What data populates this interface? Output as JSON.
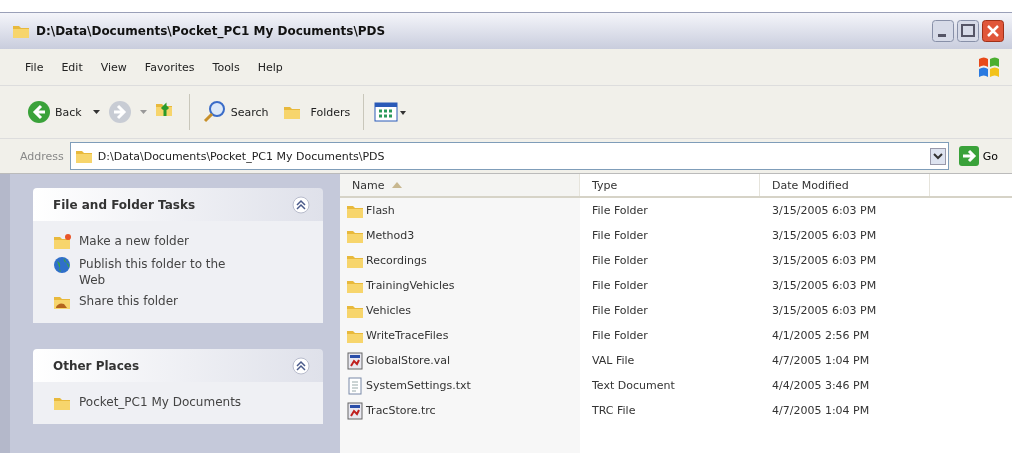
{
  "window": {
    "title": "D:\\Data\\Documents\\Pocket_PC1 My Documents\\PDS"
  },
  "menu": [
    "File",
    "Edit",
    "View",
    "Favorites",
    "Tools",
    "Help"
  ],
  "toolbar": {
    "back": "Back",
    "search": "Search",
    "folders": "Folders"
  },
  "address": {
    "label": "Address",
    "value": "D:\\Data\\Documents\\Pocket_PC1 My Documents\\PDS",
    "go": "Go"
  },
  "sidebar": [
    {
      "title": "File and Folder Tasks",
      "expanded": true,
      "items": [
        {
          "kind": "new-folder",
          "label": "Make a new folder"
        },
        {
          "kind": "globe",
          "label": "Publish this folder to the Web"
        },
        {
          "kind": "share",
          "label": "Share this folder"
        }
      ]
    },
    {
      "title": "Other Places",
      "expanded": true,
      "items": [
        {
          "kind": "folder",
          "label": "Pocket_PC1 My Documents"
        }
      ]
    }
  ],
  "table": {
    "columns": [
      {
        "label": "Name",
        "sorted": true
      },
      {
        "label": "Type",
        "sorted": false
      },
      {
        "label": "Date Modified",
        "sorted": false
      }
    ],
    "rows": [
      {
        "kind": "folder",
        "name": "Flash",
        "type": "File Folder",
        "date": "3/15/2005 6:03 PM"
      },
      {
        "kind": "folder",
        "name": "Method3",
        "type": "File Folder",
        "date": "3/15/2005 6:03 PM"
      },
      {
        "kind": "folder",
        "name": "Recordings",
        "type": "File Folder",
        "date": "3/15/2005 6:03 PM"
      },
      {
        "kind": "folder",
        "name": "TrainingVehicles",
        "type": "File Folder",
        "date": "3/15/2005 6:03 PM"
      },
      {
        "kind": "folder",
        "name": "Vehicles",
        "type": "File Folder",
        "date": "3/15/2005 6:03 PM"
      },
      {
        "kind": "folder",
        "name": "WriteTraceFiles",
        "type": "File Folder",
        "date": "4/1/2005 2:56 PM"
      },
      {
        "kind": "app",
        "name": "GlobalStore.val",
        "type": "VAL File",
        "date": "4/7/2005 1:04 PM"
      },
      {
        "kind": "text",
        "name": "SystemSettings.txt",
        "type": "Text Document",
        "date": "4/4/2005 3:46 PM"
      },
      {
        "kind": "app",
        "name": "TracStore.trc",
        "type": "TRC File",
        "date": "4/7/2005 1:04 PM"
      }
    ]
  }
}
